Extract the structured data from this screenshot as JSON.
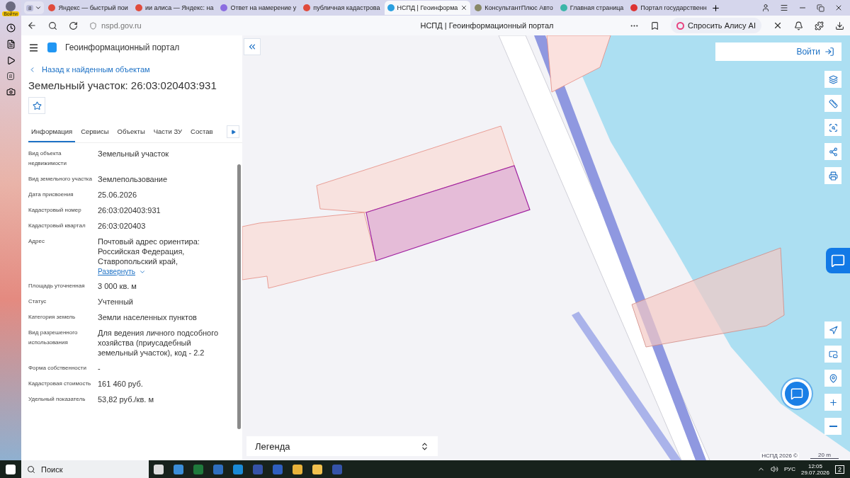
{
  "browser": {
    "profile_label": "Войти",
    "tab_group": "8",
    "tabs": [
      {
        "title": "Яндекс — быстрый пои",
        "selected": false
      },
      {
        "title": "ии алиса — Яндекс: на",
        "selected": false
      },
      {
        "title": "Ответ на намерение у",
        "selected": false
      },
      {
        "title": "публичная кадастрова",
        "selected": false
      },
      {
        "title": "НСПД | Геоинформа",
        "selected": true
      },
      {
        "title": "КонсультантПлюс Авто",
        "selected": false
      },
      {
        "title": "Главная страница",
        "selected": false
      },
      {
        "title": "Портал государственн",
        "selected": false
      }
    ],
    "address": "nspd.gov.ru",
    "page_title": "НСПД | Геоинформационный портал",
    "alice_button": "Спросить Алису AI",
    "side_badge": "8"
  },
  "portal": {
    "title": "Геоинформационный портал",
    "back_link": "Назад к найденным объектам",
    "heading": "Земельный участок: 26:03:020403:931",
    "tabs": [
      {
        "label": "Информация",
        "selected": true
      },
      {
        "label": "Сервисы",
        "selected": false
      },
      {
        "label": "Объекты",
        "selected": false
      },
      {
        "label": "Части ЗУ",
        "selected": false
      },
      {
        "label": "Состав",
        "selected": false
      }
    ],
    "fields": [
      {
        "label": "Вид объекта недвижимости",
        "value": "Земельный участок"
      },
      {
        "label": "Вид земельного участка",
        "value": "Землепользование"
      },
      {
        "label": "Дата присвоения",
        "value": "25.06.2026"
      },
      {
        "label": "Кадастровый номер",
        "value": "26:03:020403:931"
      },
      {
        "label": "Кадастровый квартал",
        "value": "26:03:020403"
      },
      {
        "label": "Адрес",
        "value": "Почтовый адрес ориентира: Российская Федерация, Ставропольский край,",
        "link": "Развернуть"
      },
      {
        "label": "Площадь уточненная",
        "value": "3 000 кв. м"
      },
      {
        "label": "Статус",
        "value": "Учтенный"
      },
      {
        "label": "Категория земель",
        "value": "Земли населенных пунктов"
      },
      {
        "label": "Вид разрешенного использования",
        "value": "Для ведения личного подсобного хозяйства (приусадебный земельный участок), код - 2.2"
      },
      {
        "label": "Форма собственности",
        "value": "-"
      },
      {
        "label": "Кадастровая стоимость",
        "value": "161 460 руб."
      },
      {
        "label": "Удельный показатель",
        "value": "53,82 руб./кв. м"
      }
    ]
  },
  "map": {
    "login": "Войти",
    "legend": "Легенда",
    "attribution": "НСПД 2026 ©",
    "scale": "20 m"
  },
  "taskbar": {
    "search": "Поиск",
    "language": "РУС",
    "time": "12:05",
    "date": "29.07.2026",
    "notifications": "2"
  }
}
